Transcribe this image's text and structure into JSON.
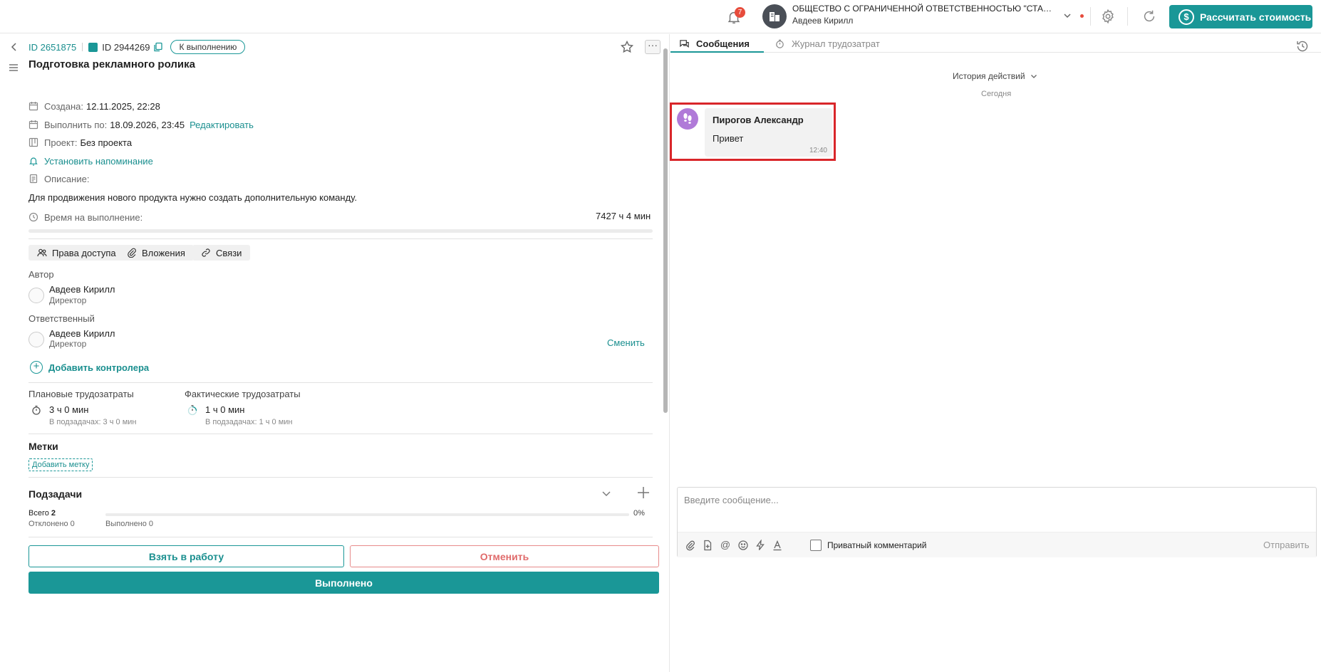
{
  "topbar": {
    "notifications_count": "7",
    "org_name": "ОБЩЕСТВО С ОГРАНИЧЕННОЙ ОТВЕТСТВЕННОСТЬЮ \"СТАРСАВТО\"...",
    "org_user": "Авдеев Кирилл",
    "calc_button": "Рассчитать стоимость",
    "calc_icon": "$"
  },
  "task": {
    "id": "ID 2651875",
    "sub_id": "ID 2944269",
    "status": "К выполнению",
    "more_label": "···",
    "title": "Подготовка рекламного ролика",
    "created_label": "Создана:",
    "created_value": "12.11.2025, 22:28",
    "due_label": "Выполнить по:",
    "due_value": "18.09.2026, 23:45",
    "edit_link": "Редактировать",
    "project_label": "Проект:",
    "project_value": "Без проекта",
    "reminder": "Установить напоминание",
    "description_label": "Описание:",
    "description_text": "Для продвижения нового продукта нужно создать дополнительную команду.",
    "time_label": "Время на выполнение:",
    "time_value": "7427 ч 4 мин"
  },
  "chips": {
    "access": "Права доступа",
    "attachments": "Вложения",
    "links": "Связи"
  },
  "people": {
    "author_label": "Автор",
    "author_name": "Авдеев Кирилл",
    "author_role": "Директор",
    "assignee_label": "Ответственный",
    "assignee_name": "Авдеев Кирилл",
    "assignee_role": "Директор",
    "change_link": "Сменить",
    "add_controller": "Добавить контролера",
    "add_controller_icon": "+"
  },
  "effort": {
    "planned_label": "Плановые трудозатраты",
    "planned_value": "3 ч 0 мин",
    "planned_sub": "В подзадачах: 3 ч 0 мин",
    "actual_label": "Фактические трудозатраты",
    "actual_value": "1 ч 0 мин",
    "actual_sub": "В подзадачах: 1 ч 0 мин"
  },
  "tags": {
    "title": "Метки",
    "add": "Добавить метку"
  },
  "subtasks": {
    "title": "Подзадачи",
    "total_label": "Всего",
    "total_value": "2",
    "progress": "0%",
    "rejected": "Отклонено 0",
    "completed": "Выполнено 0"
  },
  "actions": {
    "take": "Взять в работу",
    "cancel": "Отменить",
    "done": "Выполнено"
  },
  "chat": {
    "tab_messages": "Сообщения",
    "tab_journal": "Журнал трудозатрат",
    "history": "История действий",
    "today": "Сегодня",
    "message": {
      "author": "Пирогов Александр",
      "text": "Привет",
      "time": "12:40"
    },
    "placeholder": "Введите сообщение...",
    "private_label": "Приватный комментарий",
    "send": "Отправить",
    "mention_icon": "@"
  },
  "colors": {
    "accent": "#1a9797",
    "danger": "#e06b6b",
    "avatar_purple": "#b07ad8",
    "highlight": "#d9262a"
  }
}
